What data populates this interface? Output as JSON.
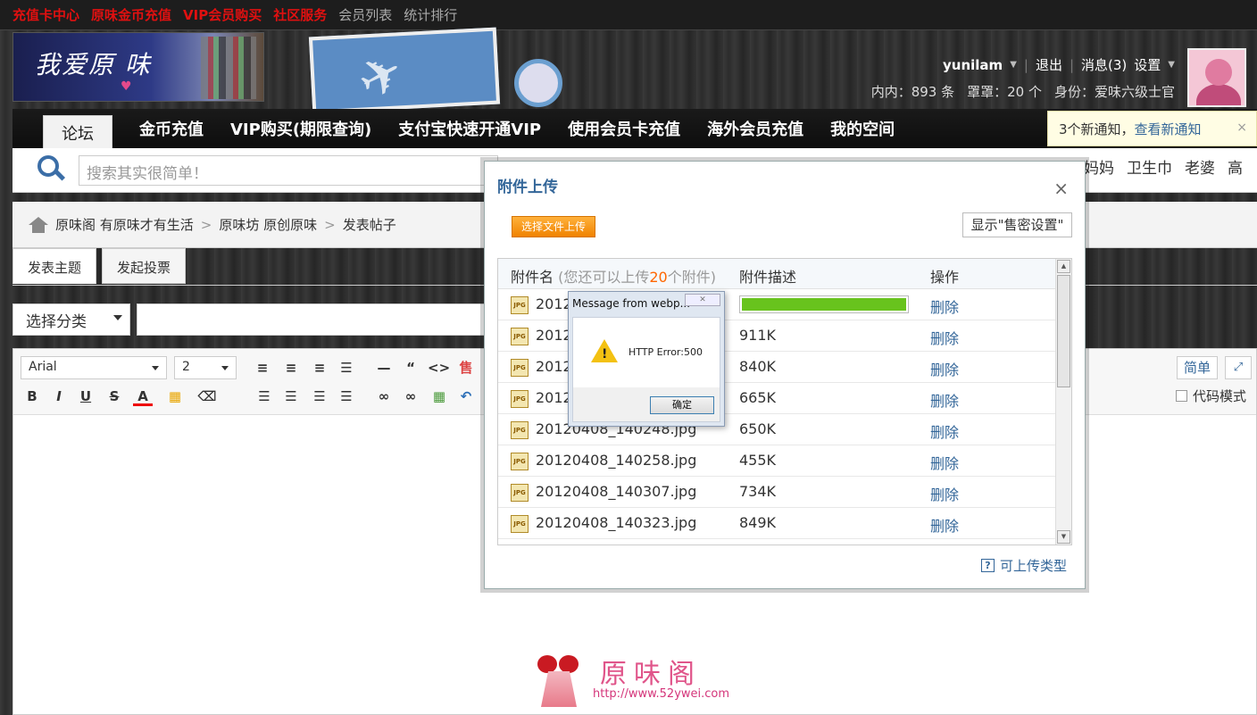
{
  "top_links": [
    {
      "label": "充值卡中心",
      "color": "#e01010"
    },
    {
      "label": "原味金币充值",
      "color": "#e01010"
    },
    {
      "label": "VIP会员购买",
      "color": "#e01010"
    },
    {
      "label": "社区服务",
      "color": "#e01010"
    },
    {
      "label": "会员列表",
      "color": "#aaaaaa"
    },
    {
      "label": "统计排行",
      "color": "#aaaaaa"
    }
  ],
  "header": {
    "username": "yunilam",
    "logout": "退出",
    "messages": "消息(3)",
    "settings": "设置",
    "stat_neinei": "内内：893 条",
    "stat_zhaozhao": "罩罩：20 个",
    "stat_identity": "身份：爱味六级士官"
  },
  "nav": {
    "items": [
      "论坛",
      "金币充值",
      "VIP购买(期限查询)",
      "支付宝快速开通VIP",
      "使用会员卡充值",
      "海外会员充值",
      "我的空间"
    ]
  },
  "notice": {
    "text": "3个新通知，",
    "link": "查看新通知",
    "close": "×"
  },
  "search": {
    "placeholder": "搜索其实很简单！",
    "hot_words": [
      "妈妈",
      "卫生巾",
      "老婆",
      "高"
    ]
  },
  "breadcrumb": [
    "原味阁 有原味才有生活",
    "原味坊 原创原味",
    "发表帖子"
  ],
  "post_tabs": [
    "发表主题",
    "发起投票"
  ],
  "form": {
    "category": "选择分类"
  },
  "editor": {
    "font": "Arial",
    "size": "2",
    "simple": "简单",
    "code_mode": "代码模式"
  },
  "watermark": {
    "name": "原味阁",
    "url": "http://www.52ywei.com"
  },
  "dialog": {
    "title": "附件上传",
    "close": "×",
    "upload_btn": "选择文件上传",
    "display_setting": "显示\"售密设置\"",
    "col_name": "附件名",
    "col_note_pre": "(您还可以上传",
    "col_note_num": "20",
    "col_note_post": "个附件)",
    "col_desc": "附件描述",
    "col_action": "操作",
    "allowed_types": "可上传类型",
    "rows": [
      {
        "name": "20120",
        "size": "",
        "progress": 1.0,
        "action": "删除"
      },
      {
        "name": "20120",
        "size": "911K",
        "action": "删除"
      },
      {
        "name": "20120",
        "size": "840K",
        "action": "删除"
      },
      {
        "name": "20120",
        "size": "665K",
        "action": "删除"
      },
      {
        "name": "20120408_140248.jpg",
        "size": "650K",
        "action": "删除"
      },
      {
        "name": "20120408_140258.jpg",
        "size": "455K",
        "action": "删除"
      },
      {
        "name": "20120408_140307.jpg",
        "size": "734K",
        "action": "删除"
      },
      {
        "name": "20120408_140323.jpg",
        "size": "849K",
        "action": "删除"
      }
    ]
  },
  "alert": {
    "title": "Message from webp...",
    "message": "HTTP Error:500",
    "ok": "确定"
  },
  "colors": {
    "link_blue": "#336699",
    "top_red": "#e01010",
    "progress_green": "#68c31d",
    "upload_orange": "#f08300"
  }
}
